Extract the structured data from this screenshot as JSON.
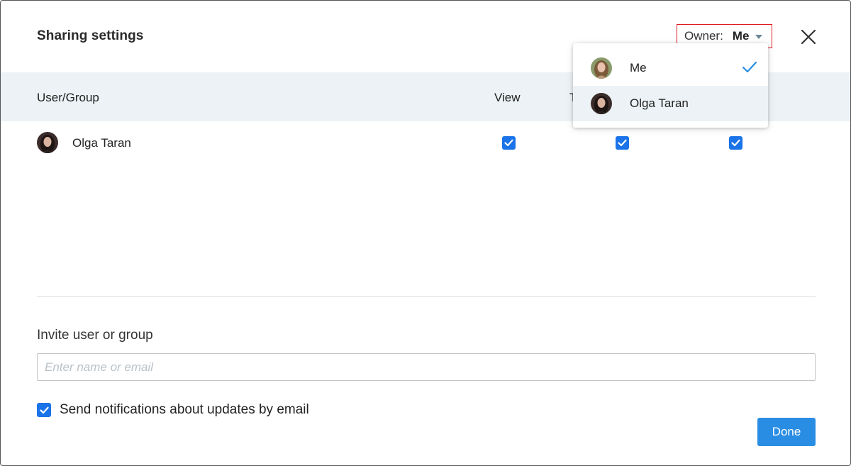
{
  "dialog": {
    "title": "Sharing settings",
    "owner": {
      "label": "Owner:",
      "value": "Me"
    }
  },
  "table": {
    "headers": {
      "user": "User/Group",
      "view": "View",
      "edit_partial": "T"
    },
    "rows": [
      {
        "name": "Olga Taran",
        "permissions": [
          true,
          true,
          true
        ]
      }
    ]
  },
  "dropdown": {
    "items": [
      {
        "name": "Me",
        "selected": true
      },
      {
        "name": "Olga Taran",
        "selected": false
      }
    ]
  },
  "invite": {
    "label": "Invite user or group",
    "placeholder": "Enter name or email",
    "value": ""
  },
  "notify": {
    "label": "Send notifications about updates by email",
    "checked": true
  },
  "footer": {
    "done_label": "Done"
  },
  "colors": {
    "accent": "#2a8de4",
    "checkbox": "#1a73e8",
    "header_bg": "#ecf2f5",
    "highlight_border": "#e0191f"
  }
}
